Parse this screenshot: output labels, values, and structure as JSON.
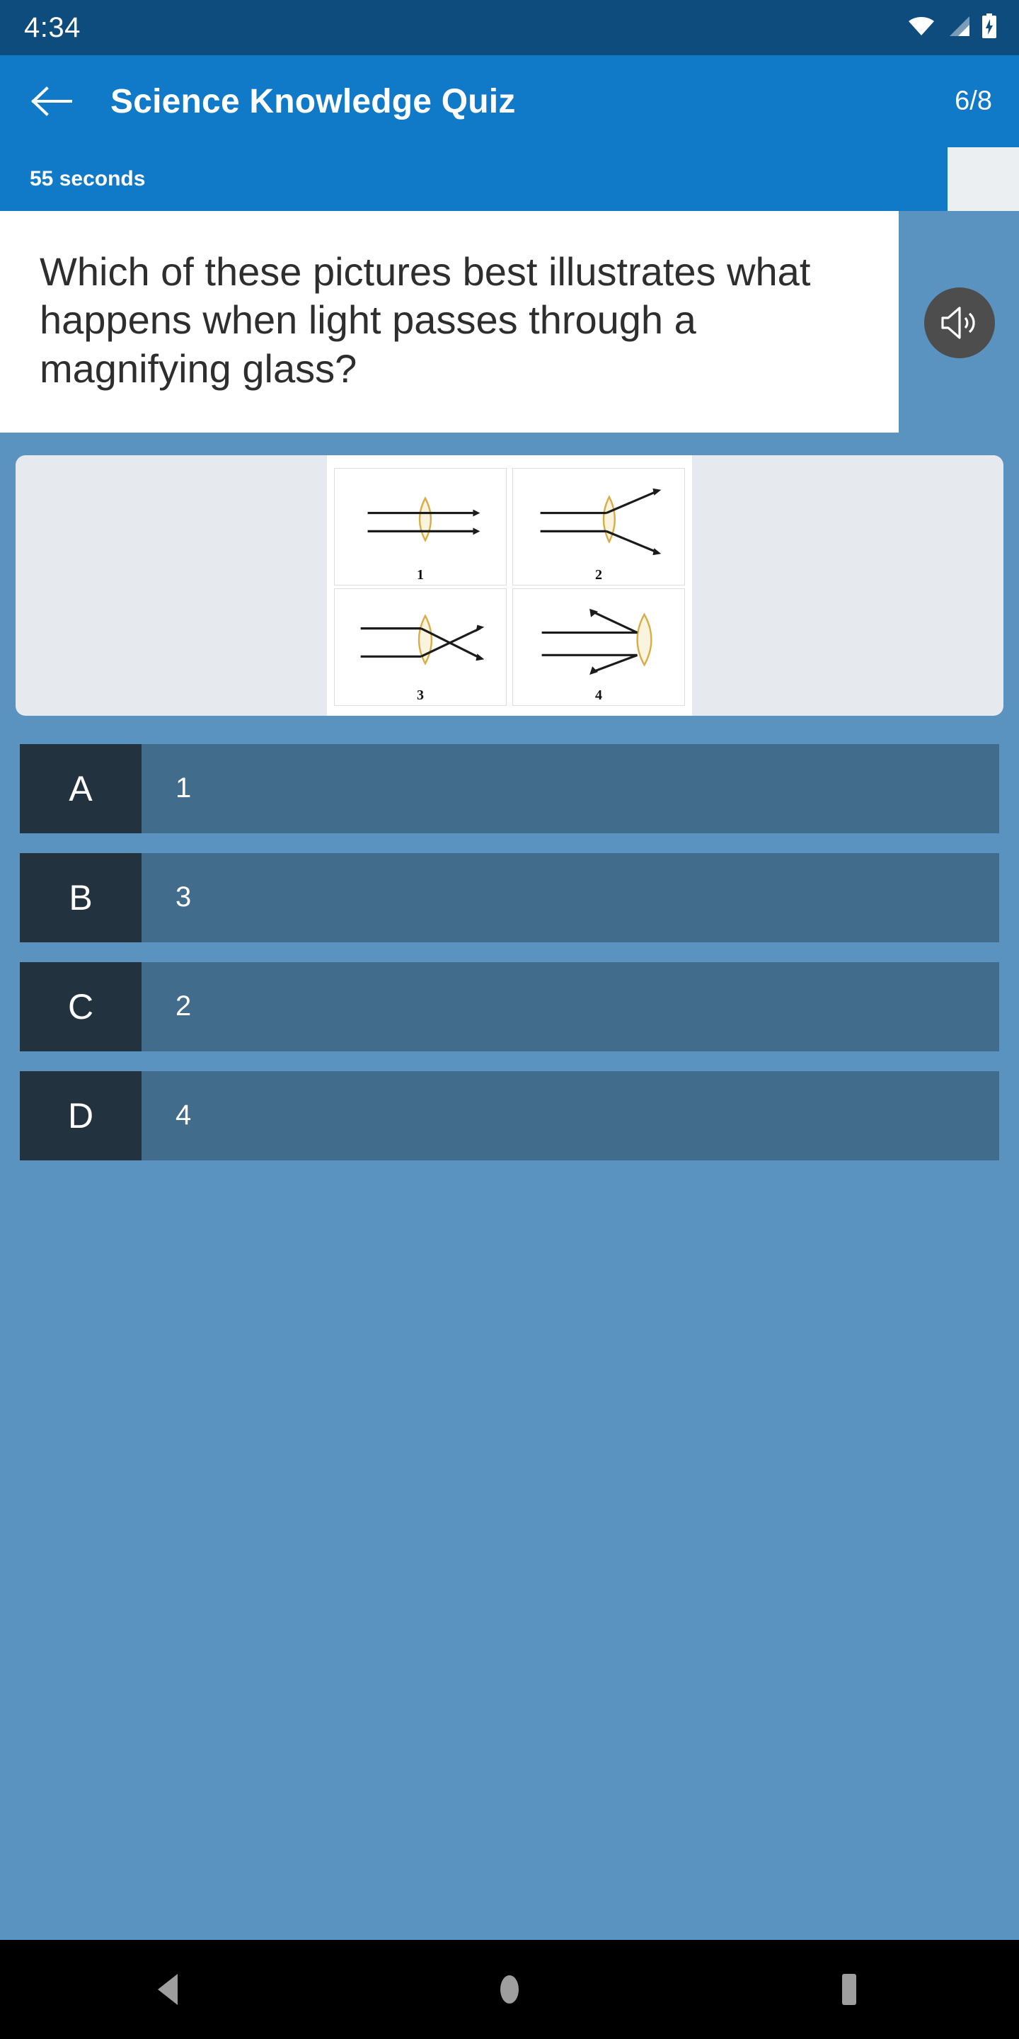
{
  "status_bar": {
    "time": "4:34",
    "icons": [
      "wifi-icon",
      "cell-signal-icon",
      "battery-charging-icon"
    ]
  },
  "app_bar": {
    "back_icon": "back-arrow-icon",
    "title": "Science Knowledge Quiz",
    "counter": "6/8",
    "background_color": "#1079c8"
  },
  "timer": {
    "label": "55 seconds",
    "progress_percent": 93,
    "fill_color": "#1079c8",
    "track_color": "#eceff1"
  },
  "question": {
    "text": "Which of these pictures best illustrates what happens when light passes through a magnifying glass?",
    "speaker_icon": "volume-speaker-icon"
  },
  "diagrams": [
    {
      "label": "1",
      "description": "parallel rays pass straight through the convex lens unchanged"
    },
    {
      "label": "2",
      "description": "parallel rays diverge after the convex lens"
    },
    {
      "label": "3",
      "description": "parallel rays converge and cross after the convex lens"
    },
    {
      "label": "4",
      "description": "rays reflect backwards off the convex lens"
    }
  ],
  "answers": [
    {
      "letter": "A",
      "text": "1"
    },
    {
      "letter": "B",
      "text": "3"
    },
    {
      "letter": "C",
      "text": "2"
    },
    {
      "letter": "D",
      "text": "4"
    }
  ],
  "nav_bar": {
    "back": "nav-back-icon",
    "home": "nav-home-icon",
    "recents": "nav-recents-icon"
  },
  "theme": {
    "page_background": "#5b93c0",
    "letter_box": "#22323f",
    "answer_body": "#426c8c",
    "status_bar": "#0d4c7c",
    "lens_color": "#d9ac45"
  }
}
